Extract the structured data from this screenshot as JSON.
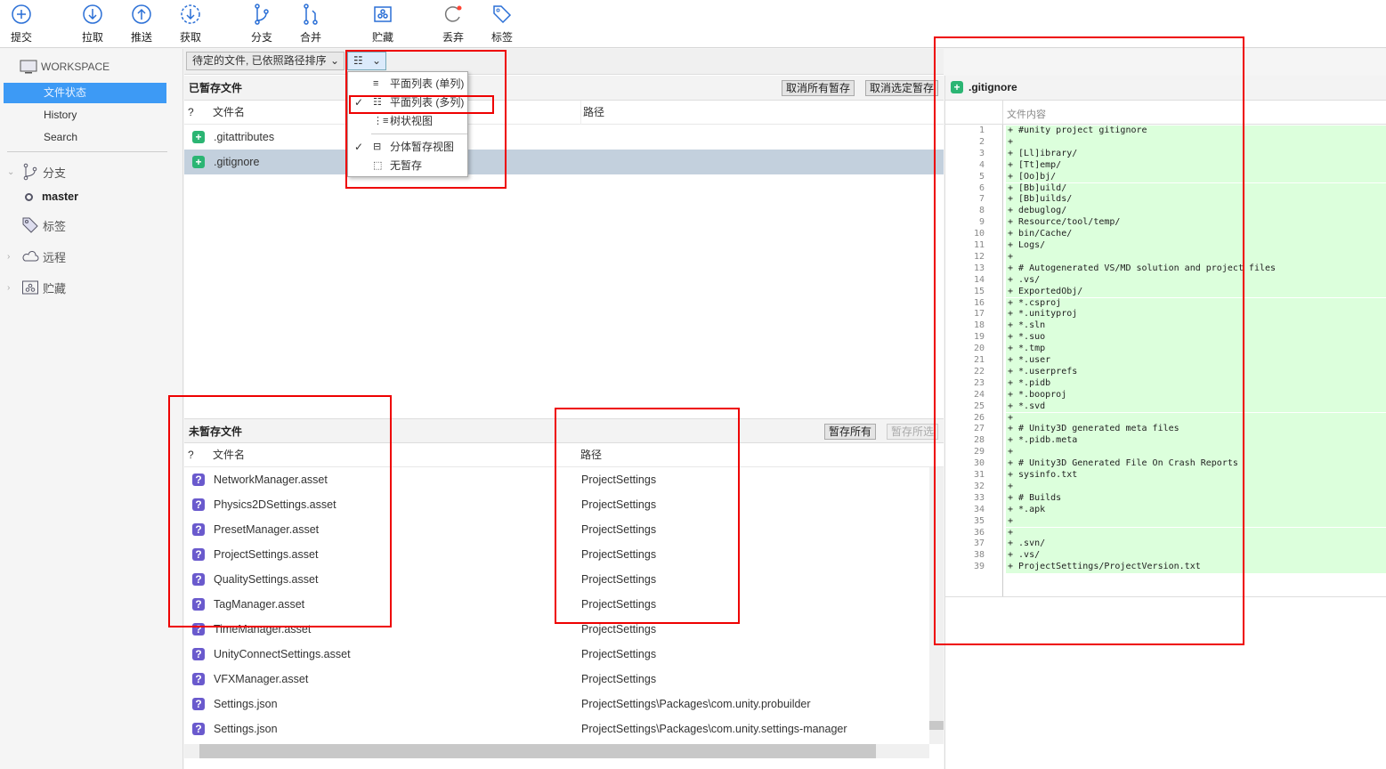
{
  "toolbar": [
    {
      "label": "提交",
      "icon": "commit-icon"
    },
    {
      "label": "拉取",
      "icon": "pull-icon"
    },
    {
      "label": "推送",
      "icon": "push-icon"
    },
    {
      "label": "获取",
      "icon": "fetch-icon"
    },
    {
      "label": "分支",
      "icon": "branch-icon"
    },
    {
      "label": "合并",
      "icon": "merge-icon"
    },
    {
      "label": "贮藏",
      "icon": "stash-icon"
    },
    {
      "label": "丢弃",
      "icon": "discard-icon"
    },
    {
      "label": "标签",
      "icon": "tag-icon"
    }
  ],
  "sidebar": {
    "workspace": "WORKSPACE",
    "items": [
      "文件状态",
      "History",
      "Search"
    ],
    "branches": "分支",
    "current_branch": "master",
    "tags": "标签",
    "remotes": "远程",
    "stashes": "贮藏"
  },
  "filter": {
    "sort": "待定的文件, 已依照路径排序"
  },
  "menu": {
    "items": [
      {
        "label": "平面列表 (单列)",
        "checked": false,
        "icon": "single-list-icon"
      },
      {
        "label": "平面列表 (多列)",
        "checked": true,
        "icon": "multi-list-icon"
      },
      {
        "label": "树状视图",
        "checked": false,
        "icon": "tree-view-icon"
      },
      {
        "label": "分体暂存视图",
        "checked": true,
        "icon": "split-view-icon"
      },
      {
        "label": "无暂存",
        "checked": false,
        "icon": "no-staging-icon"
      }
    ]
  },
  "staged": {
    "title": "已暂存文件",
    "unstage_all": "取消所有暂存",
    "unstage_selected": "取消选定暂存",
    "col_status": "?",
    "col_name": "文件名",
    "col_path": "路径",
    "files": [
      {
        "name": ".gitattributes",
        "path": ""
      },
      {
        "name": ".gitignore",
        "path": "",
        "selected": true
      }
    ]
  },
  "unstaged": {
    "title": "未暂存文件",
    "stage_all": "暂存所有",
    "stage_selected": "暂存所选",
    "col_status": "?",
    "col_name": "文件名",
    "col_path": "路径",
    "files": [
      {
        "name": "NetworkManager.asset",
        "path": "ProjectSettings"
      },
      {
        "name": "Physics2DSettings.asset",
        "path": "ProjectSettings"
      },
      {
        "name": "PresetManager.asset",
        "path": "ProjectSettings"
      },
      {
        "name": "ProjectSettings.asset",
        "path": "ProjectSettings"
      },
      {
        "name": "QualitySettings.asset",
        "path": "ProjectSettings"
      },
      {
        "name": "TagManager.asset",
        "path": "ProjectSettings"
      },
      {
        "name": "TimeManager.asset",
        "path": "ProjectSettings"
      },
      {
        "name": "UnityConnectSettings.asset",
        "path": "ProjectSettings"
      },
      {
        "name": "VFXManager.asset",
        "path": "ProjectSettings"
      },
      {
        "name": "Settings.json",
        "path": "ProjectSettings\\Packages\\com.unity.probuilder"
      },
      {
        "name": "Settings.json",
        "path": "ProjectSettings\\Packages\\com.unity.settings-manager"
      }
    ]
  },
  "diff": {
    "file": ".gitignore",
    "col_header": "文件内容",
    "lines": [
      "+ #unity project gitignore",
      "+",
      "+ [Ll]ibrary/",
      "+ [Tt]emp/",
      "+ [Oo]bj/",
      "+ [Bb]uild/",
      "+ [Bb]uilds/",
      "+ debuglog/",
      "+ Resource/tool/temp/",
      "+ bin/Cache/",
      "+ Logs/",
      "+",
      "+ # Autogenerated VS/MD solution and project files",
      "+ .vs/",
      "+ ExportedObj/",
      "+ *.csproj",
      "+ *.unityproj",
      "+ *.sln",
      "+ *.suo",
      "+ *.tmp",
      "+ *.user",
      "+ *.userprefs",
      "+ *.pidb",
      "+ *.booproj",
      "+ *.svd",
      "+",
      "+ # Unity3D generated meta files",
      "+ *.pidb.meta",
      "+",
      "+ # Unity3D Generated File On Crash Reports",
      "+ sysinfo.txt",
      "+",
      "+ # Builds",
      "+ *.apk",
      "+",
      "+",
      "+ .svn/",
      "+ .vs/",
      "+ ProjectSettings/ProjectVersion.txt"
    ]
  },
  "colors": {
    "accent": "#3d9af5",
    "added": "#2bb573",
    "untracked": "#6a5acd",
    "diff_add_bg": "#dcffdc",
    "selected_row": "#c3d0dd",
    "annotation": "#e00000"
  }
}
